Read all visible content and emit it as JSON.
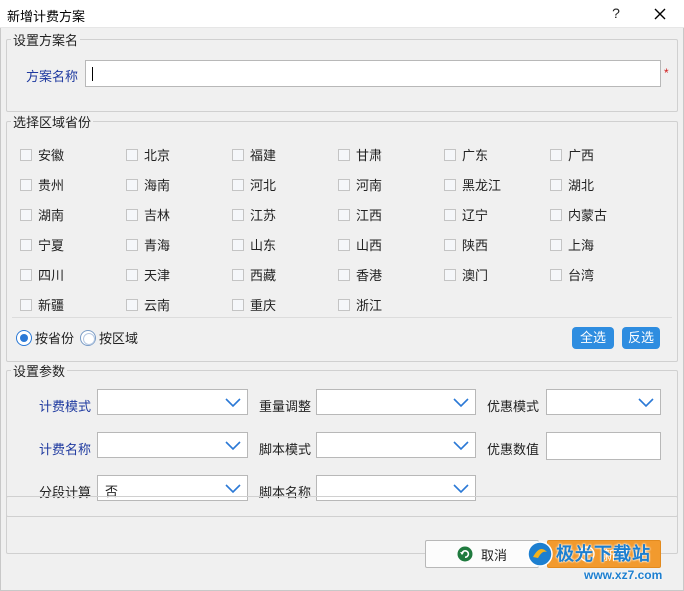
{
  "window": {
    "title": "新增计费方案",
    "help_label": "?"
  },
  "scheme_name": {
    "legend": "设置方案名",
    "label": "方案名称",
    "value": "",
    "required_mark": "*"
  },
  "region": {
    "legend": "选择区域省份",
    "provinces": [
      "安徽",
      "北京",
      "福建",
      "甘肃",
      "广东",
      "广西",
      "贵州",
      "海南",
      "河北",
      "河南",
      "黑龙江",
      "湖北",
      "湖南",
      "吉林",
      "江苏",
      "江西",
      "辽宁",
      "内蒙古",
      "宁夏",
      "青海",
      "山东",
      "山西",
      "陕西",
      "上海",
      "四川",
      "天津",
      "西藏",
      "香港",
      "澳门",
      "台湾",
      "新疆",
      "云南",
      "重庆",
      "浙江"
    ],
    "mode_options": [
      {
        "label": "按省份",
        "selected": true
      },
      {
        "label": "按区域",
        "selected": false
      }
    ],
    "select_all_label": "全选",
    "invert_label": "反选"
  },
  "params": {
    "legend": "设置参数",
    "billing_mode": {
      "label": "计费模式",
      "value": ""
    },
    "weight_adjust": {
      "label": "重量调整",
      "value": ""
    },
    "discount_mode": {
      "label": "优惠模式",
      "value": ""
    },
    "billing_name": {
      "label": "计费名称",
      "value": ""
    },
    "script_mode": {
      "label": "脚本模式",
      "value": ""
    },
    "discount_value": {
      "label": "优惠数值",
      "value": ""
    },
    "segment_calc": {
      "label": "分段计算",
      "value": "否"
    },
    "script_name": {
      "label": "脚本名称",
      "value": ""
    }
  },
  "footer": {
    "cancel_label": "取消",
    "add_label": "新增"
  },
  "watermark": {
    "text": "极光下载站",
    "url": "www.xz7.com"
  },
  "colors": {
    "accent": "#2e8de0",
    "ok_button": "#f29a2e",
    "label_blue": "#1f3aa0",
    "required": "#d01b1b"
  }
}
